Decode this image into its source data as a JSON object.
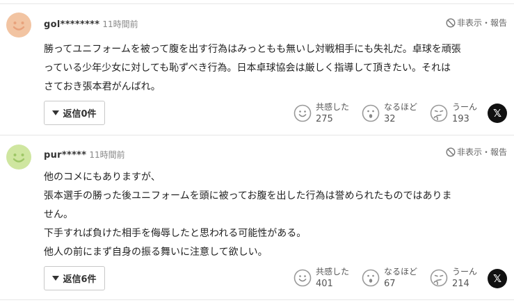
{
  "comments": [
    {
      "username": "gol********",
      "time": "11時間前",
      "report_label": "非表示・報告",
      "avatar_color": "#f2c4a2",
      "avatar_face_color": "#e8a27c",
      "lines": [
        "勝ってユニフォームを被って腹を出す行為はみっともも無いし対戦相手にも失礼だ。卓球を頑張",
        "っている少年少女に対しても恥ずべき行為。日本卓球協会は厳しく指導して頂きたい。それは",
        "さておき張本君がんばれ。"
      ],
      "reply_label": "返信0件",
      "reactions": [
        {
          "icon": "smile-icon",
          "label": "共感した",
          "count": "275"
        },
        {
          "icon": "surprise-icon",
          "label": "なるほど",
          "count": "32"
        },
        {
          "icon": "thinking-icon",
          "label": "うーん",
          "count": "193"
        }
      ],
      "share_icon": "x-logo-icon"
    },
    {
      "username": "pur*****",
      "time": "11時間前",
      "report_label": "非表示・報告",
      "avatar_color": "#cfe6a0",
      "avatar_face_color": "#9ec766",
      "lines": [
        "他のコメにもありますが、",
        "張本選手の勝った後ユニフォームを頭に被ってお腹を出した行為は誉められたものではありま",
        "せん。",
        "下手すれば負けた相手を侮辱したと思われる可能性がある。",
        "他人の前にまず自身の振る舞いに注意して欲しい。"
      ],
      "reply_label": "返信6件",
      "reactions": [
        {
          "icon": "smile-icon",
          "label": "共感した",
          "count": "401"
        },
        {
          "icon": "surprise-icon",
          "label": "なるほど",
          "count": "67"
        },
        {
          "icon": "thinking-icon",
          "label": "うーん",
          "count": "214"
        }
      ],
      "share_icon": "x-logo-icon"
    }
  ],
  "x_glyph": "𝕏"
}
